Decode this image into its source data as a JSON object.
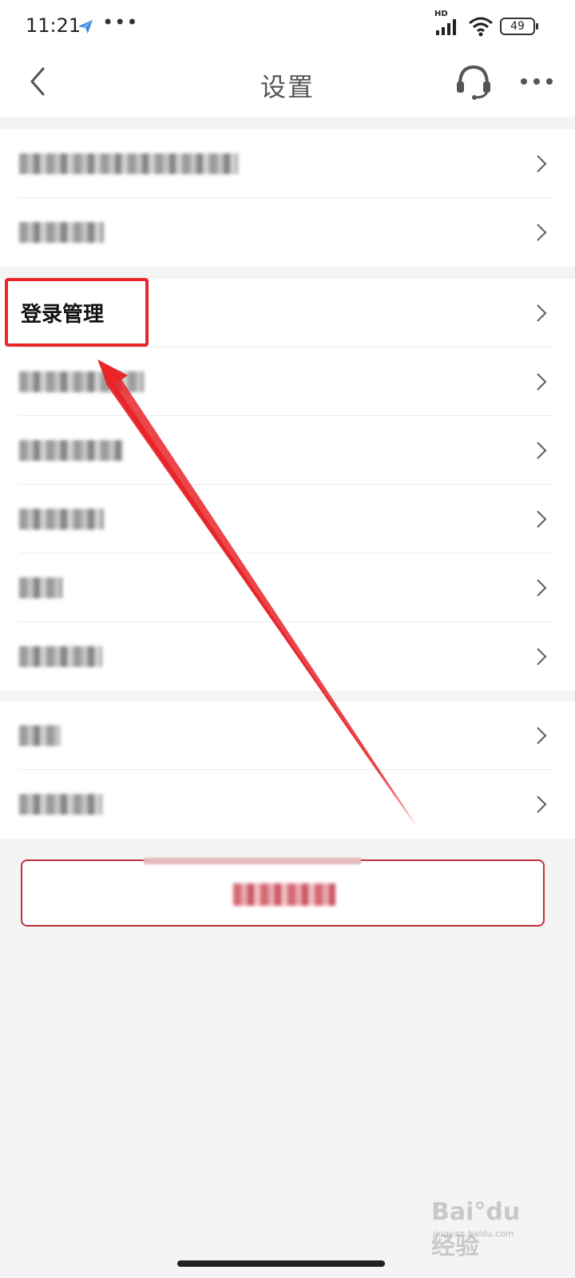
{
  "status_bar": {
    "time": "11:21",
    "dots": "•••",
    "network_label": "HD",
    "battery": "49",
    "app_icon": "send-plane-icon"
  },
  "nav": {
    "title": "设置",
    "icons": [
      "back-chevron-icon",
      "headset-icon",
      "more-dots-icon"
    ]
  },
  "groups": [
    {
      "rows": [
        {
          "label": ""
        },
        {
          "label": ""
        }
      ]
    },
    {
      "rows": [
        {
          "label": "登录管理"
        },
        {
          "label": ""
        },
        {
          "label": ""
        },
        {
          "label": ""
        },
        {
          "label": ""
        },
        {
          "label": ""
        }
      ]
    },
    {
      "rows": [
        {
          "label": ""
        },
        {
          "label": ""
        }
      ]
    }
  ],
  "logout": {
    "label": ""
  },
  "watermark": {
    "brand": "Bai°du 经验",
    "domain": "jingyan.baidu.com"
  },
  "colors": {
    "accent": "#e8262a",
    "logout_border": "#c0303a",
    "background": "#f4f4f4"
  }
}
